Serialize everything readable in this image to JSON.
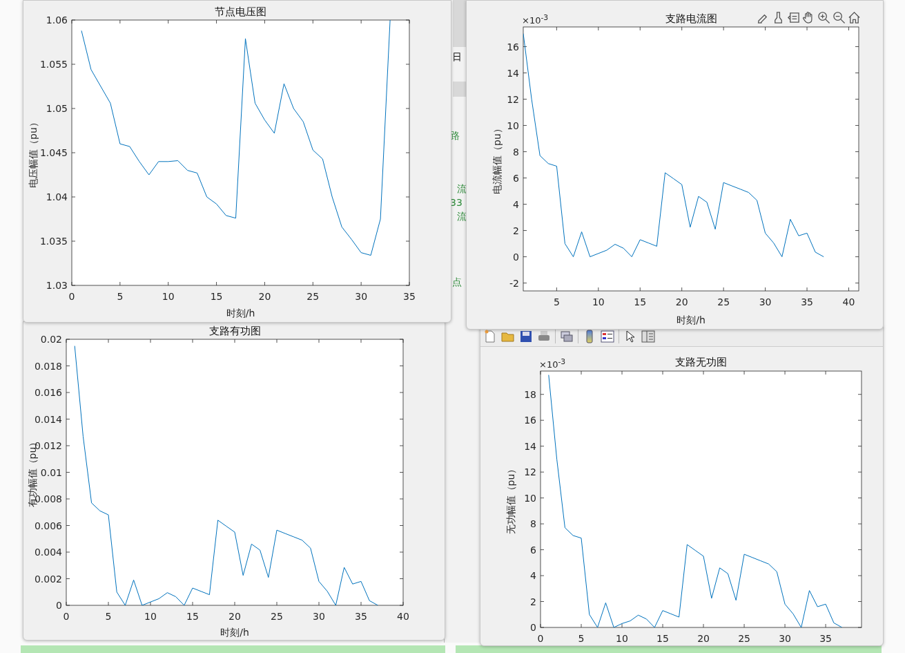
{
  "background": {
    "fragments": [
      "日",
      "路",
      "流",
      "33",
      "流",
      "点"
    ]
  },
  "figures": [
    {
      "chart_data": {
        "type": "line",
        "title": "节点电压图",
        "xlabel": "时刻/h",
        "ylabel": "电压幅值（pu）",
        "x": [
          1,
          2,
          3,
          4,
          5,
          6,
          7,
          8,
          9,
          10,
          11,
          12,
          13,
          14,
          15,
          16,
          17,
          18,
          19,
          20,
          21,
          22,
          23,
          24,
          25,
          26,
          27,
          28,
          29,
          30,
          31,
          32,
          33
        ],
        "series": [
          {
            "color": "#0072bd",
            "values": [
              1.0588,
              1.0544,
              1.0525,
              1.0506,
              1.046,
              1.0457,
              1.044,
              1.0425,
              1.044,
              1.044,
              1.0441,
              1.043,
              1.0427,
              1.04,
              1.0392,
              1.0379,
              1.0376,
              1.0579,
              1.0506,
              1.0487,
              1.0472,
              1.0528,
              1.05,
              1.0485,
              1.0453,
              1.0443,
              1.04,
              1.0366,
              1.0352,
              1.0337,
              1.0334,
              1.0375,
              1.06
            ]
          }
        ],
        "xlim": [
          0,
          35
        ],
        "ylim": [
          1.03,
          1.06
        ],
        "xticks": [
          0,
          5,
          10,
          15,
          20,
          25,
          30,
          35
        ],
        "yticks": [
          1.03,
          1.035,
          1.04,
          1.045,
          1.05,
          1.055,
          1.06
        ]
      }
    },
    {
      "exponent_label": "×10$^{-3}$",
      "chart_data": {
        "type": "line",
        "title": "支路电流图",
        "xlabel": "时刻/h",
        "ylabel": "电流幅值（pu）",
        "x": [
          1,
          2,
          3,
          4,
          5,
          6,
          7,
          8,
          9,
          10,
          11,
          12,
          13,
          14,
          15,
          16,
          17,
          18,
          19,
          20,
          21,
          22,
          23,
          24,
          25,
          26,
          27,
          28,
          29,
          30,
          31,
          32,
          33,
          34,
          35,
          36,
          37
        ],
        "series": [
          {
            "color": "#0072bd",
            "values": [
              17,
              12,
              7.7,
              7.1,
              6.9,
              1,
              0,
              1.9,
              0,
              0.25,
              0.5,
              0.95,
              0.65,
              0,
              1.3,
              1.05,
              0.8,
              6.4,
              5.95,
              5.5,
              2.25,
              4.6,
              4.15,
              2.1,
              5.65,
              5.4,
              5.15,
              4.9,
              4.3,
              1.8,
              1.05,
              0,
              2.85,
              1.6,
              1.8,
              0.35,
              0
            ]
          }
        ],
        "xlim": [
          1,
          41.2
        ],
        "ylim": [
          -2.6,
          17.5
        ],
        "xticks": [
          5,
          10,
          15,
          20,
          25,
          30,
          35,
          40
        ],
        "yticks": [
          -2,
          0,
          2,
          4,
          6,
          8,
          10,
          12,
          14,
          16
        ]
      }
    },
    {
      "chart_data": {
        "type": "line",
        "title": "支路有功图",
        "xlabel": "时刻/h",
        "ylabel": "有功幅值（pu）",
        "x": [
          1,
          2,
          3,
          4,
          5,
          6,
          7,
          8,
          9,
          10,
          11,
          12,
          13,
          14,
          15,
          16,
          17,
          18,
          19,
          20,
          21,
          22,
          23,
          24,
          25,
          26,
          27,
          28,
          29,
          30,
          31,
          32,
          33,
          34,
          35,
          36,
          37
        ],
        "series": [
          {
            "color": "#0072bd",
            "values": [
              0.0195,
              0.0127,
              0.0077,
              0.0071,
              0.0068,
              0.001,
              0,
              0.0019,
              0,
              0.00025,
              0.0005,
              0.00095,
              0.00065,
              0,
              0.0013,
              0.00105,
              0.0008,
              0.0064,
              0.00595,
              0.0055,
              0.00225,
              0.0046,
              0.00415,
              0.0021,
              0.00565,
              0.0054,
              0.00515,
              0.0049,
              0.0043,
              0.0018,
              0.00105,
              0,
              0.00285,
              0.0016,
              0.0018,
              0.00035,
              0
            ]
          }
        ],
        "xlim": [
          0,
          40
        ],
        "ylim": [
          0,
          0.02
        ],
        "xticks": [
          0,
          5,
          10,
          15,
          20,
          25,
          30,
          35,
          40
        ],
        "yticks": [
          0,
          0.002,
          0.004,
          0.006,
          0.008,
          0.01,
          0.012,
          0.014,
          0.016,
          0.018,
          0.02
        ]
      }
    },
    {
      "exponent_label": "×10$^{-3}$",
      "chart_data": {
        "type": "line",
        "title": "支路无功图",
        "ylabel": "无功幅值（pu）",
        "x": [
          1,
          2,
          3,
          4,
          5,
          6,
          7,
          8,
          9,
          10,
          11,
          12,
          13,
          14,
          15,
          16,
          17,
          18,
          19,
          20,
          21,
          22,
          23,
          24,
          25,
          26,
          27,
          28,
          29,
          30,
          31,
          32,
          33,
          34,
          35,
          36,
          37
        ],
        "series": [
          {
            "color": "#0072bd",
            "values": [
              19.5,
              13,
              7.7,
              7.1,
              6.9,
              1,
              0,
              1.9,
              0,
              0.3,
              0.5,
              0.95,
              0.65,
              0,
              1.3,
              1.05,
              0.8,
              6.4,
              5.95,
              5.5,
              2.25,
              4.6,
              4.15,
              2.1,
              5.65,
              5.4,
              5.15,
              4.9,
              4.3,
              1.8,
              1.05,
              0,
              2.85,
              1.6,
              1.8,
              0.35,
              0
            ]
          }
        ],
        "xlim": [
          0,
          39.4
        ],
        "ylim": [
          0,
          19.8
        ],
        "xticks": [
          0,
          5,
          10,
          15,
          20,
          25,
          30,
          35
        ],
        "yticks": [
          0,
          2,
          4,
          6,
          8,
          10,
          12,
          14,
          16,
          18
        ]
      }
    }
  ]
}
